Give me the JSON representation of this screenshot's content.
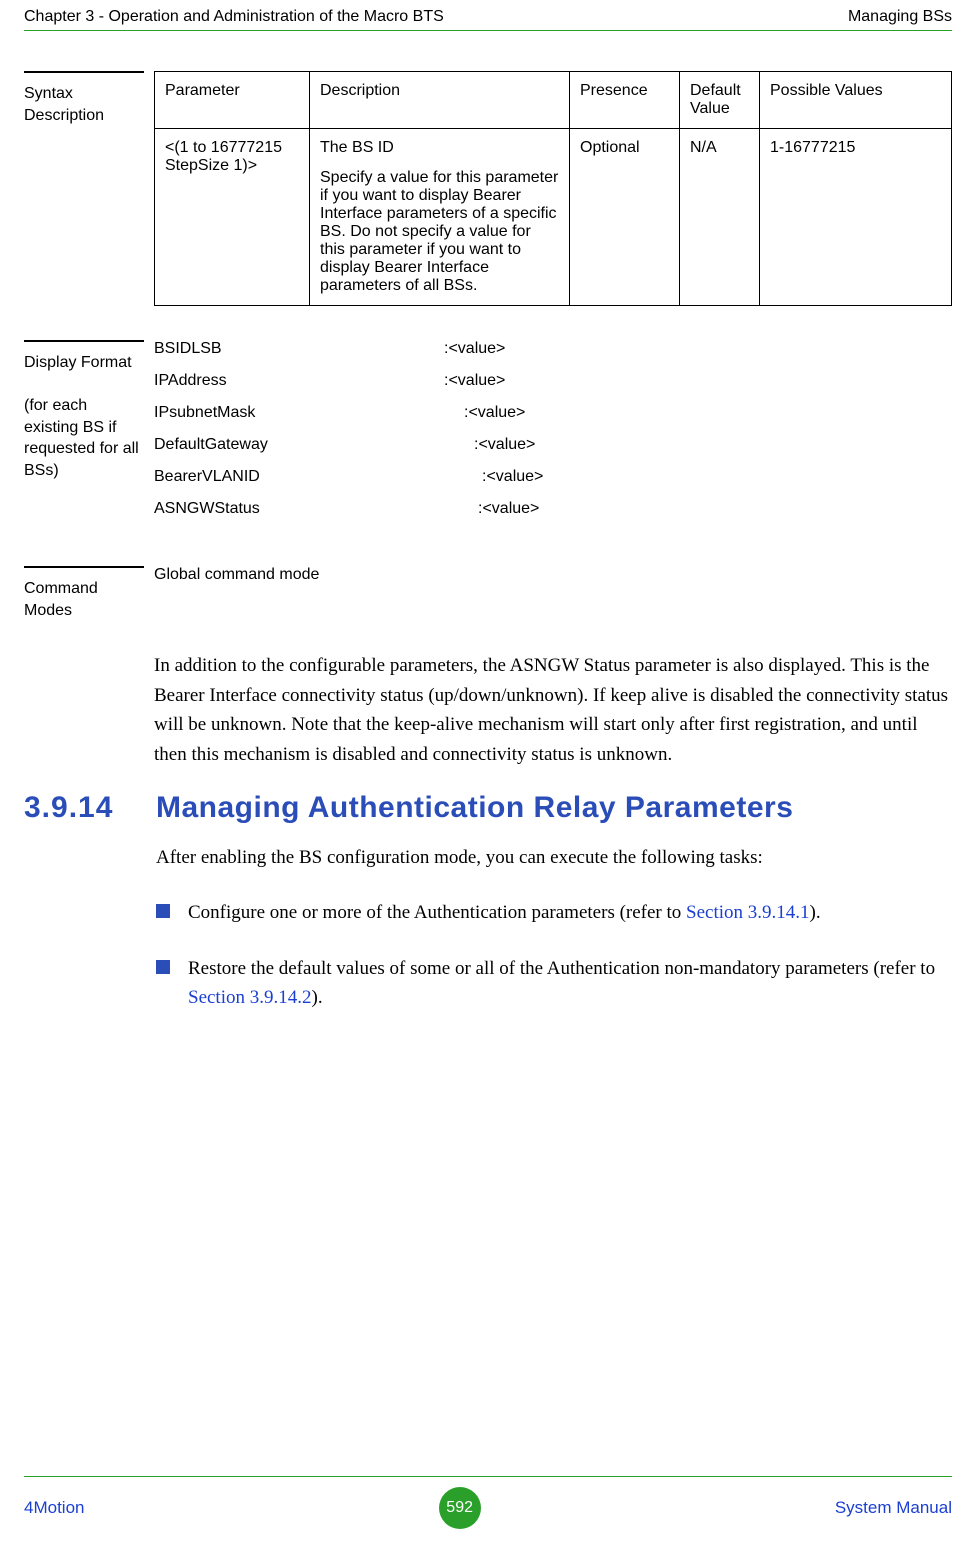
{
  "header": {
    "left": "Chapter 3 - Operation and Administration of the Macro BTS",
    "right": "Managing BSs"
  },
  "syntax": {
    "label": "Syntax Description",
    "headers": {
      "parameter": "Parameter",
      "description": "Description",
      "presence": "Presence",
      "default": "Default Value",
      "possible": "Possible Values"
    },
    "row": {
      "parameter": "<(1 to 16777215 StepSize 1)>",
      "desc_line1": "The BS ID",
      "desc_line2": "Specify a value for this parameter if you want to display Bearer Interface parameters of a specific BS. Do not specify a value for this parameter if you want to display Bearer Interface parameters of all BSs.",
      "presence": "Optional",
      "default": "N/A",
      "possible": "1-16777215"
    }
  },
  "display": {
    "label_line1": "Display Format",
    "label_line2": "(for each existing BS if requested for all BSs)",
    "rows": [
      {
        "key": "BSIDLSB",
        "val": ":<value>"
      },
      {
        "key": "IPAddress",
        "val": ":<value>"
      },
      {
        "key": "IPsubnetMask",
        "val": ":<value>"
      },
      {
        "key": "DefaultGateway",
        "val": ":<value>"
      },
      {
        "key": "BearerVLANID",
        "val": ":<value>"
      },
      {
        "key": "ASNGWStatus",
        "val": ":<value>"
      }
    ]
  },
  "command_modes": {
    "label": "Command Modes",
    "value": "Global command mode"
  },
  "body": {
    "paragraph": "In addition to the configurable parameters, the ASNGW Status parameter is also displayed. This is the Bearer Interface connectivity status (up/down/unknown). If keep alive is disabled the connectivity status will be unknown. Note that the keep-alive mechanism will start only after first registration, and until then this mechanism is disabled and connectivity status is unknown."
  },
  "section": {
    "number": "3.9.14",
    "title": "Managing Authentication Relay Parameters",
    "intro": "After enabling the BS configuration mode, you can execute the following tasks:",
    "bullets": [
      {
        "pre": "Configure one or more of the Authentication parameters (refer to ",
        "link": "Section 3.9.14.1",
        "post": ")."
      },
      {
        "pre": "Restore the default values of some or all of the Authentication non-mandatory parameters (refer to ",
        "link": "Section 3.9.14.2",
        "post": ")."
      }
    ]
  },
  "footer": {
    "left": "4Motion",
    "page": "592",
    "right": "System Manual"
  }
}
